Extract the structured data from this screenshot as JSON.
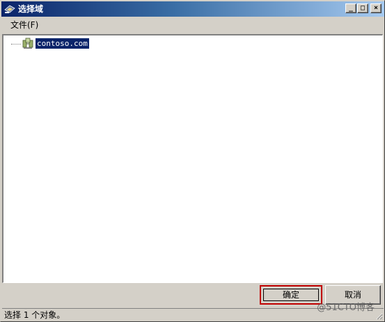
{
  "window": {
    "title": "选择域",
    "minimize_glyph": "_",
    "maximize_glyph": "□",
    "close_glyph": "×"
  },
  "menu": {
    "items": [
      {
        "label": "文件(F)"
      }
    ]
  },
  "tree": {
    "items": [
      {
        "label": "contoso.com",
        "icon": "domain-icon",
        "selected": true
      }
    ]
  },
  "buttons": {
    "ok_label": "确定",
    "cancel_label": "取消"
  },
  "status": {
    "text": "选择 1 个对象。"
  },
  "watermark": {
    "text": "@51CTO博客"
  },
  "colors": {
    "selection": "#0a246a",
    "highlight_box": "#c00000",
    "window_face": "#d4d0c8"
  }
}
